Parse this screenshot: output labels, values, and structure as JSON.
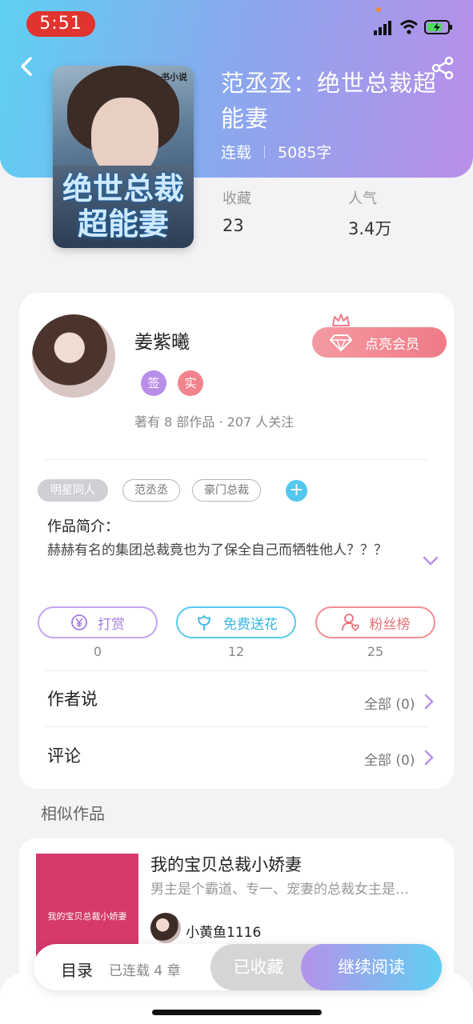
{
  "status_bar": {
    "time": "5:51"
  },
  "book": {
    "title": "范丞丞：绝世总裁超能妻",
    "status": "连载",
    "word_count": "5085字",
    "cover_text": "绝世总裁超能妻",
    "cover_logo": "书小说",
    "stats": [
      {
        "label": "收藏",
        "value": "23"
      },
      {
        "label": "人气",
        "value": "3.4万"
      }
    ]
  },
  "author": {
    "name": "姜紫曦",
    "badges": [
      "签",
      "实"
    ],
    "summary": "著有 8 部作品 · 207 人关注",
    "vip_button": "点亮会员"
  },
  "tags": [
    "明星同人",
    "范丞丞",
    "豪门总裁"
  ],
  "intro": {
    "label": "作品简介：",
    "text": "赫赫有名的集团总裁竟也为了保全自己而牺牲他人？？？"
  },
  "actions": [
    {
      "label": "打赏",
      "count": "0",
      "icon": "yen-coin-icon"
    },
    {
      "label": "免费送花",
      "count": "12",
      "icon": "flower-icon"
    },
    {
      "label": "粉丝榜",
      "count": "25",
      "icon": "fan-user-icon"
    }
  ],
  "rows": [
    {
      "label": "作者说",
      "value": "全部 (0)"
    },
    {
      "label": "评论",
      "value": "全部 (0)"
    }
  ],
  "similar": {
    "heading": "相似作品",
    "items": [
      {
        "title": "我的宝贝总裁小娇妻",
        "desc": "男主是个霸道、专一、宠妻的总裁女主是…",
        "author": "小黄鱼1116",
        "cover_text": "我的宝贝总裁小娇妻"
      }
    ]
  },
  "bottom_bar": {
    "toc": "目录",
    "chapters": "已连载 4 章",
    "collected": "已收藏",
    "continue": "继续阅读"
  },
  "colors": {
    "header_gradient": [
      "#5ed0f3",
      "#b98ee9"
    ],
    "reward": "#a57de0",
    "flower": "#36b6e2",
    "fans": "#ea6f78",
    "vip": "#ef7b87"
  }
}
